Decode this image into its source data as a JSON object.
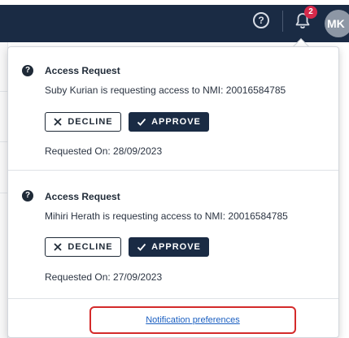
{
  "header": {
    "help_glyph": "?",
    "badge_count": "2",
    "avatar_initials": "MK"
  },
  "notifications": [
    {
      "title": "Access Request",
      "message": "Suby Kurian is requesting access to NMI: 20016584785",
      "decline_label": "DECLINE",
      "approve_label": "APPROVE",
      "requested_on": "Requested On: 28/09/2023"
    },
    {
      "title": "Access Request",
      "message": "Mihiri Herath is requesting access to NMI: 20016584785",
      "decline_label": "DECLINE",
      "approve_label": "APPROVE",
      "requested_on": "Requested On: 27/09/2023"
    }
  ],
  "footer": {
    "preferences_link": "Notification preferences"
  },
  "icons": {
    "help": "help-circle-icon",
    "notifications": "bell-icon",
    "item": "question-circle-icon",
    "decline": "x-icon",
    "approve": "check-icon"
  },
  "colors": {
    "topbar": "#1a2b44",
    "badge": "#d6294a",
    "avatar": "#8d97a5",
    "approve_button": "#1a2b44",
    "link": "#1b5fc1",
    "highlight_border": "#d42a2a"
  }
}
